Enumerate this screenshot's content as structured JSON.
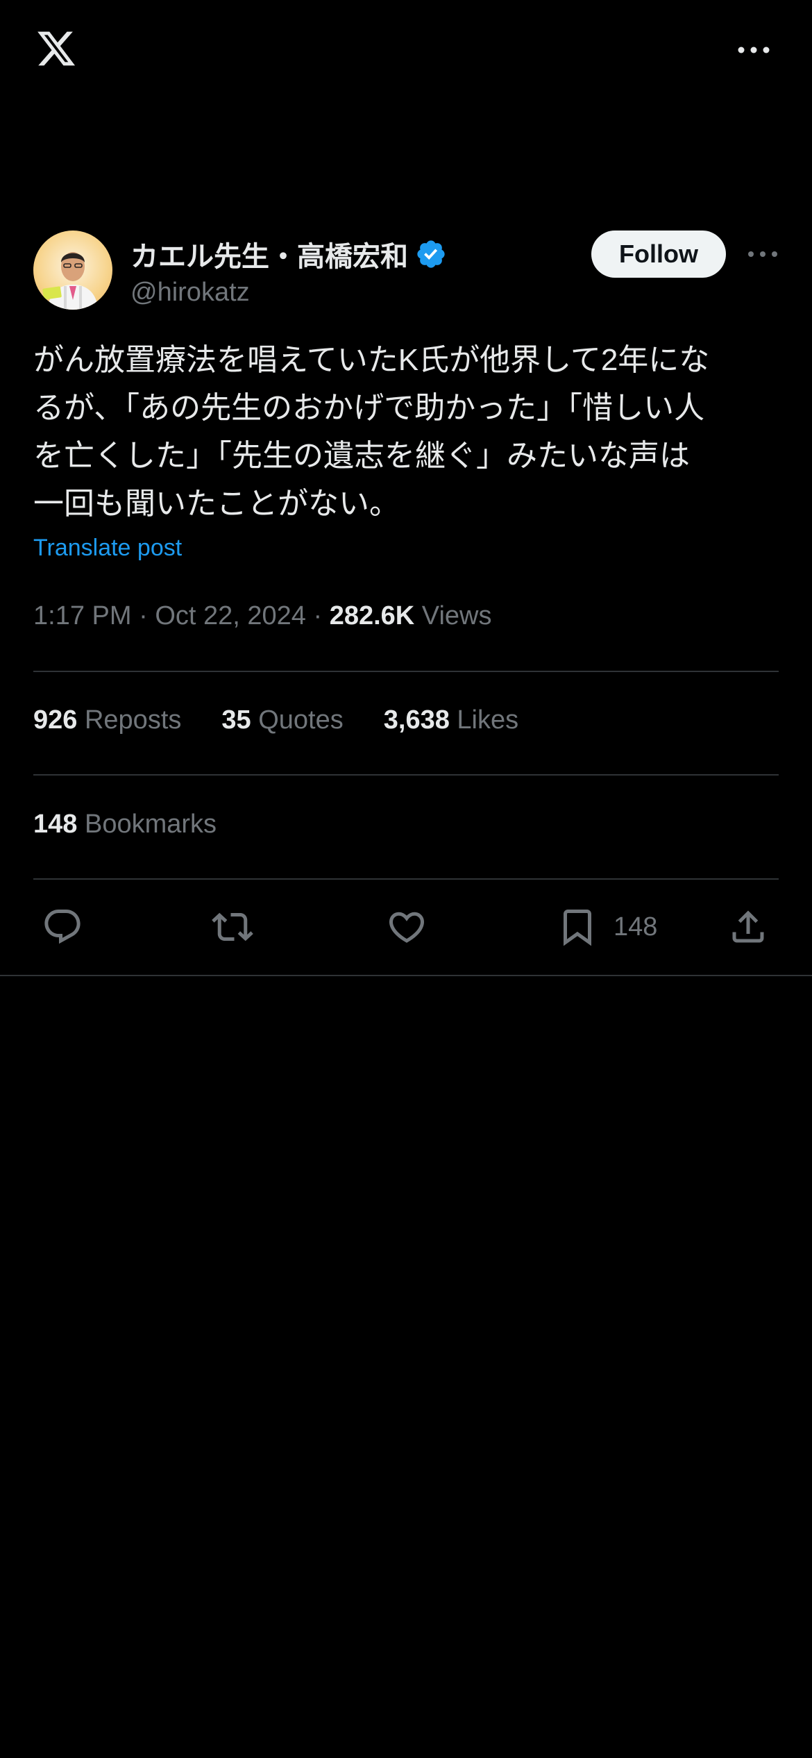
{
  "header": {
    "logo_icon": "x-logo-icon",
    "more_icon": "more-horizontal-icon"
  },
  "author": {
    "display_name": "カエル先生・高橋宏和",
    "handle": "@hirokatz",
    "verified": true,
    "follow_label": "Follow",
    "more_icon": "more-horizontal-icon"
  },
  "post": {
    "text_lines": [
      "がん放置療法を唱えていたK氏が他界して2年にな",
      "るが、「あの先生のおかげで助かった」「惜しい人",
      "を亡くした」「先生の遺志を継ぐ」みたいな声は",
      "一回も聞いたことがない。"
    ],
    "translate_label": "Translate post",
    "time": "1:17 PM",
    "separator": "·",
    "date": "Oct 22, 2024",
    "views_count": "282.6K",
    "views_label": "Views"
  },
  "stats": {
    "reposts_count": "926",
    "reposts_label": "Reposts",
    "quotes_count": "35",
    "quotes_label": "Quotes",
    "likes_count": "3,638",
    "likes_label": "Likes",
    "bookmarks_count": "148",
    "bookmarks_label": "Bookmarks"
  },
  "actions": {
    "reply_icon": "reply-icon",
    "repost_icon": "repost-icon",
    "like_icon": "heart-icon",
    "bookmark_icon": "bookmark-icon",
    "bookmark_count": "148",
    "share_icon": "share-icon"
  },
  "colors": {
    "background": "#000000",
    "text_primary": "#e7e9ea",
    "text_secondary": "#71767b",
    "accent": "#1d9bf0",
    "divider": "#2f3336",
    "follow_bg": "#eff3f4"
  }
}
